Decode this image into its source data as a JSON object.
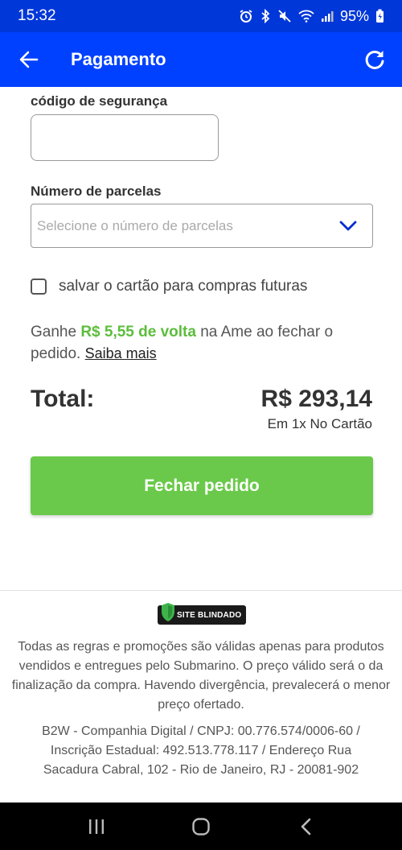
{
  "status_bar": {
    "time": "15:32",
    "battery": "95%",
    "icons": [
      "alarm-icon",
      "bluetooth-icon",
      "mute-icon",
      "wifi-icon",
      "signal-icon",
      "battery-icon"
    ]
  },
  "app_bar": {
    "title": "Pagamento",
    "back_icon": "arrow-left-icon",
    "refresh_icon": "refresh-icon",
    "background": "#0041ff"
  },
  "form": {
    "security_code_label": "código de segurança",
    "security_code_value": "",
    "installments_label": "Número de parcelas",
    "installments_placeholder": "Selecione o número de parcelas",
    "save_card_label": "salvar o cartão para compras futuras",
    "save_card_checked": false
  },
  "cashback": {
    "prefix": "Ganhe ",
    "amount": "R$ 5,55 de volta",
    "suffix": " na Ame ao fechar o pedido. ",
    "link": "Saiba mais",
    "accent": "#5cbd3c"
  },
  "total": {
    "label": "Total:",
    "value": "R$ 293,14",
    "installment_text": "Em 1x No Cartão"
  },
  "cta": {
    "label": "Fechar pedido",
    "color": "#6ac94a"
  },
  "footer": {
    "seal_text": "SITE BLINDADO",
    "notice": "Todas as regras e promoções são válidas apenas para produtos vendidos e entregues pelo Submarino. O preço válido será o da finalização da compra. Havendo divergência, prevalecerá o menor preço ofertado.",
    "company": "B2W - Companhia Digital / CNPJ: 00.776.574/0006-60 / Inscrição Estadual: 492.513.778.117 / Endereço Rua Sacadura Cabral, 102 - Rio de Janeiro, RJ - 20081-902"
  },
  "nav_bar": {
    "icons": [
      "recent-apps-icon",
      "home-icon",
      "back-icon"
    ]
  }
}
